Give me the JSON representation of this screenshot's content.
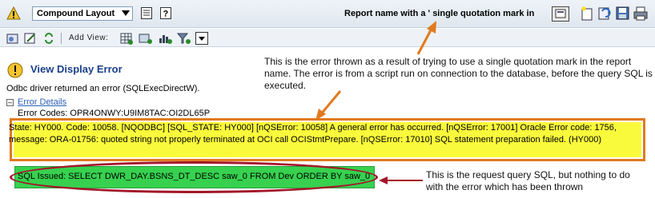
{
  "toolbar": {
    "layout_select": "Compound Layout",
    "report_name_label": "Report name with a ' single quotation mark in"
  },
  "toolbar2": {
    "add_view_label": "Add View:"
  },
  "error": {
    "title": "View Display Error",
    "message": "Odbc driver returned an error (SQLExecDirectW).",
    "details_link": "Error Details",
    "codes": "Error Codes: OPR4ONWY:U9IM8TAC:OI2DL65P",
    "state": "State: HY000. Code: 10058. [NQODBC] [SQL_STATE: HY000] [nQSError: 10058] A general error has occurred. [nQSError: 17001] Oracle Error code: 1756, message: ORA-01756: quoted string not properly terminated at OCI call OCIStmtPrepare. [nQSError: 17010] SQL statement preparation failed. (HY000)",
    "sql": "SQL Issued: SELECT DWR_DAY.BSNS_DT_DESC saw_0 FROM Dev ORDER BY saw_0"
  },
  "annotations": {
    "callout1": "This is the error thrown as a result of trying to use a single quotation mark in the report name. The error is from a script run on connection to the database, before the query SQL is executed.",
    "callout2": "This is the request query SQL, but nothing to do with the error which has been thrown"
  },
  "colors": {
    "highlight_yellow": "#fafa3c",
    "sql_green": "#37d14f",
    "callout_orange": "#e07a1e",
    "ellipse_red": "#a4172a",
    "title_blue": "#1a3f8a"
  }
}
